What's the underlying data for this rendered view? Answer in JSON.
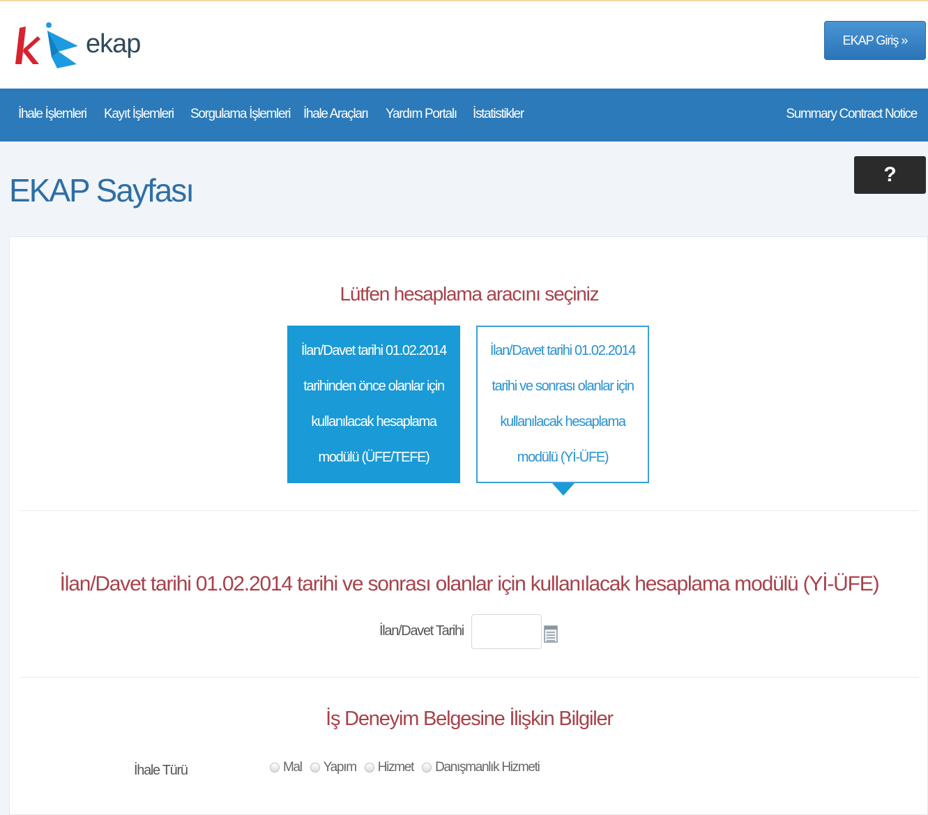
{
  "header": {
    "logo_text": "ekap",
    "login_button": "EKAP Giriş »"
  },
  "nav": {
    "items": [
      "İhale İşlemleri",
      "Kayıt İşlemleri",
      "Sorgulama İşlemleri",
      "İhale Araçları",
      "Yardım Portalı",
      "İstatistikler"
    ],
    "right_item": "Summary Contract Notice"
  },
  "page": {
    "title": "EKAP Sayfası",
    "help_label": "?"
  },
  "tool_select": {
    "heading": "Lütfen hesaplama aracını seçiniz",
    "options": [
      {
        "label": "İlan/Davet tarihi 01.02.2014 tarihinden önce olanlar için kullanılacak hesaplama modülü (ÜFE/TEFE)",
        "selected": false
      },
      {
        "label": "İlan/Davet tarihi 01.02.2014 tarihi ve sonrası olanlar için kullanılacak hesaplama modülü (Yİ-ÜFE)",
        "selected": true
      }
    ]
  },
  "module": {
    "heading": "İlan/Davet tarihi 01.02.2014 tarihi ve sonrası olanlar için kullanılacak hesaplama modülü (Yİ-ÜFE)",
    "date_label": "İlan/Davet Tarihi",
    "date_value": ""
  },
  "experience": {
    "heading": "İş Deneyim Belgesine İlişkin Bilgiler",
    "tender_type_label": "İhale Türü",
    "tender_types": [
      "Mal",
      "Yapım",
      "Hizmet",
      "Danışmanlık Hizmeti"
    ]
  },
  "colors": {
    "nav_bg": "#2c7ab9",
    "accent_blue": "#1a9ad6",
    "heading_red": "#a8414a",
    "title_blue": "#2e6ea6"
  }
}
